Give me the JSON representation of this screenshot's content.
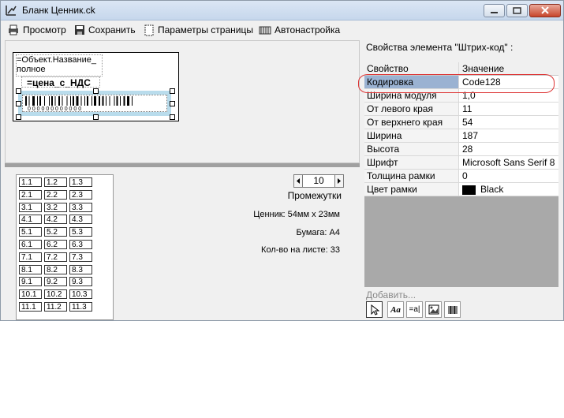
{
  "window": {
    "title": "Бланк  Ценник.ck"
  },
  "toolbar": {
    "preview": "Просмотр",
    "save": "Сохранить",
    "page_setup": "Параметры страницы",
    "auto_setup": "Автонастройка"
  },
  "design": {
    "field_name": "=Объект.Название_\nполное",
    "field_price": "=цена_с_НДС",
    "barcode_digits": "0 0 0 0 0 0 0 0 0 0 0 0"
  },
  "layout": {
    "cells": [
      [
        "1.1",
        "1.2",
        "1.3"
      ],
      [
        "2.1",
        "2.2",
        "2.3"
      ],
      [
        "3.1",
        "3.2",
        "3.3"
      ],
      [
        "4.1",
        "4.2",
        "4.3"
      ],
      [
        "5.1",
        "5.2",
        "5.3"
      ],
      [
        "6.1",
        "6.2",
        "6.3"
      ],
      [
        "7.1",
        "7.2",
        "7.3"
      ],
      [
        "8.1",
        "8.2",
        "8.3"
      ],
      [
        "9.1",
        "9.2",
        "9.3"
      ],
      [
        "10.1",
        "10.2",
        "10.3"
      ],
      [
        "11.1",
        "11.2",
        "11.3"
      ]
    ],
    "spacing_value": "10",
    "spacing_label": "Промежутки",
    "tag_size": "Ценник: 54мм x 23мм",
    "paper": "Бумага: А4",
    "per_sheet": "Кол-во на листе: 33"
  },
  "properties": {
    "caption": "Свойства элемента \"Штрих-код\" :",
    "col_property": "Свойство",
    "col_value": "Значение",
    "rows": [
      {
        "name": "Кодировка",
        "value": "Code128"
      },
      {
        "name": "Ширина модуля",
        "value": "1,0"
      },
      {
        "name": "От левого края",
        "value": "11"
      },
      {
        "name": "От верхнего края",
        "value": "54"
      },
      {
        "name": "Ширина",
        "value": "187"
      },
      {
        "name": "Высота",
        "value": "28"
      },
      {
        "name": "Шрифт",
        "value": "Microsoft Sans Serif 8"
      },
      {
        "name": "Толщина рамки",
        "value": "0"
      },
      {
        "name": "Цвет рамки",
        "value": "Black"
      }
    ],
    "selected_row": "Кодировка",
    "frame_color_swatch": "#000000"
  },
  "add_panel": {
    "caption": "Добавить...",
    "tools": [
      "pointer-tool",
      "text-tool",
      "field-tool",
      "image-tool",
      "barcode-tool"
    ],
    "tool_glyphs": {
      "text": "Aa",
      "field": "=a|"
    }
  },
  "colors": {
    "selection_row": "#9ab2d2",
    "highlight_ellipse": "#d33333"
  }
}
